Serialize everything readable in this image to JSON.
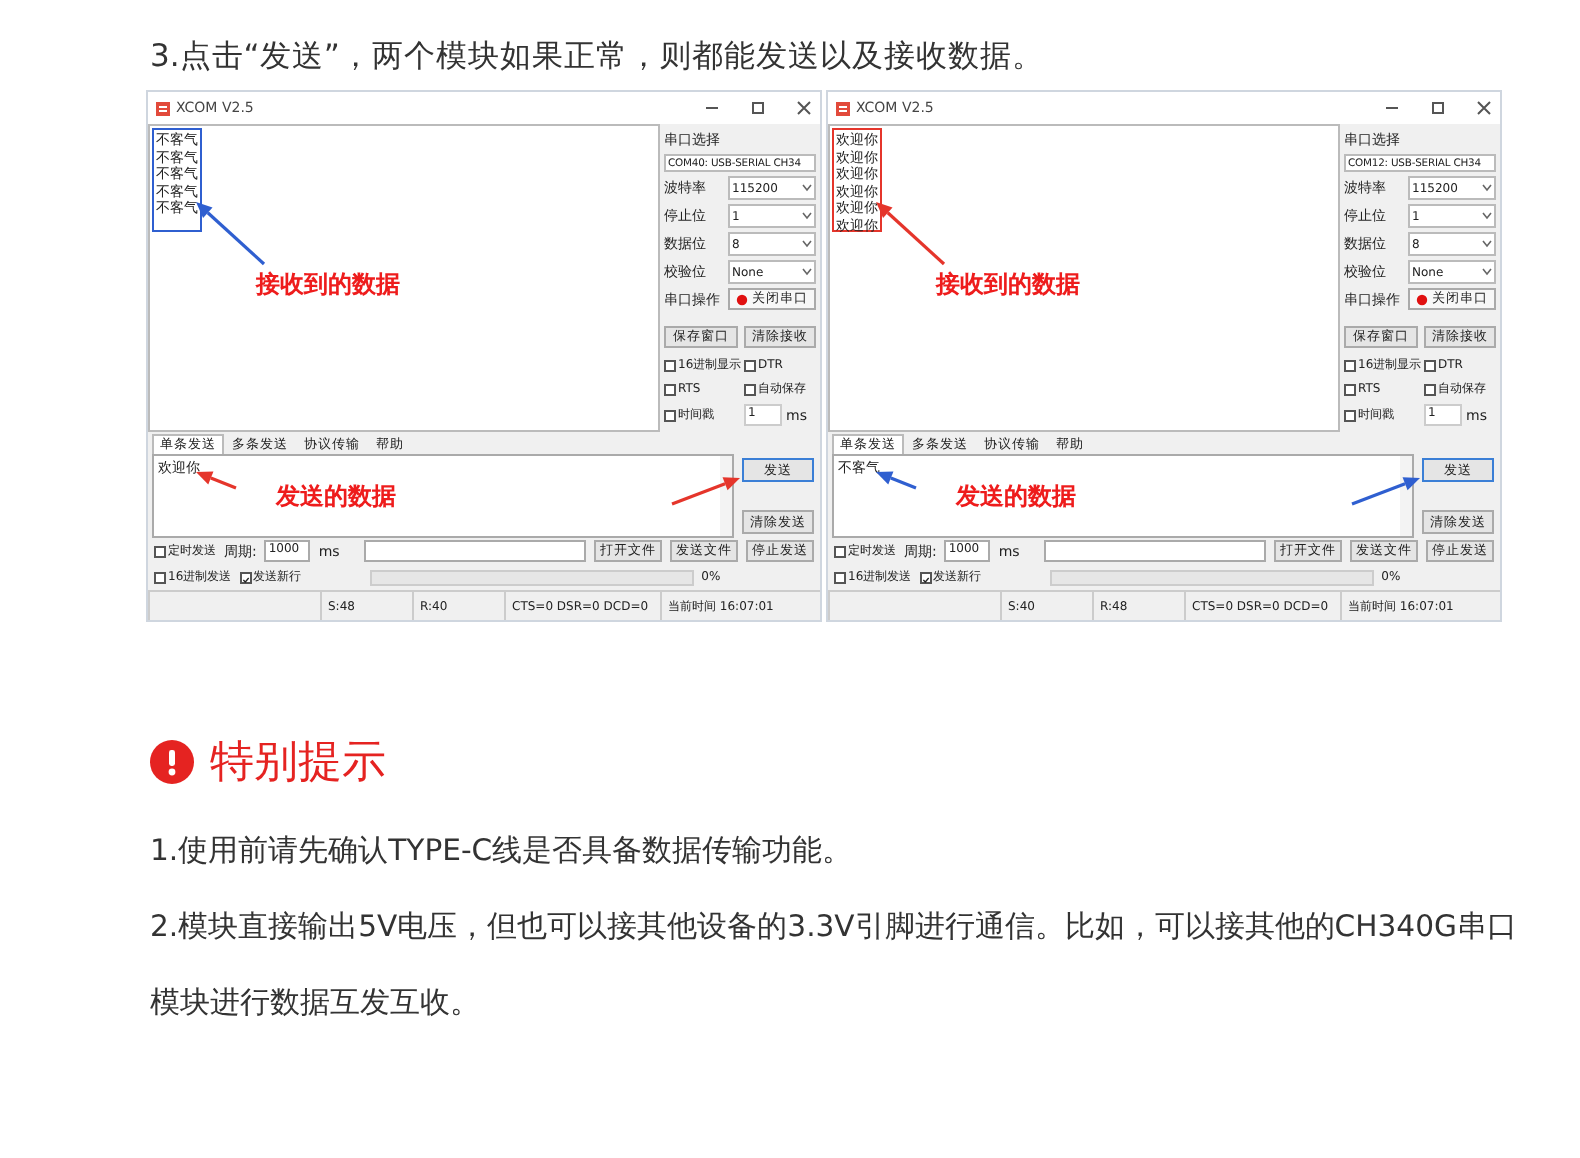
{
  "instruction": "3.点击“发送”，两个模块如果正常，则都能发送以及接收数据。",
  "windows": [
    {
      "title": "XCOM V2.5",
      "received_lines": [
        "不客气",
        "不客气",
        "不客气",
        "不客气",
        "不客气"
      ],
      "annotations": [
        {
          "kind": "received",
          "label": "接收到的数据",
          "color": "#2f5fd0"
        },
        {
          "kind": "sent",
          "label": "发送的数据",
          "color": "#e5352b"
        }
      ],
      "port_label": "串口选择",
      "port": "COM40: USB-SERIAL CH34",
      "settings": [
        {
          "label": "波特率",
          "value": "115200"
        },
        {
          "label": "停止位",
          "value": "1"
        },
        {
          "label": "数据位",
          "value": "8"
        },
        {
          "label": "校验位",
          "value": "None"
        }
      ],
      "port_op_label": "串口操作",
      "port_button": "关闭串口",
      "save_button": "保存窗口",
      "clear_receive_button": "清除接收",
      "checkboxes": [
        {
          "label": "16进制显示",
          "checked": false
        },
        {
          "label": "DTR",
          "checked": false
        },
        {
          "label": "RTS",
          "checked": false
        },
        {
          "label": "自动保存",
          "checked": false
        },
        {
          "label": "时间戳",
          "checked": false
        }
      ],
      "timestamp_value": "1",
      "timestamp_unit": "ms",
      "tabs": [
        {
          "label": "单条发送",
          "selected": true
        },
        {
          "label": "多条发送",
          "selected": false
        },
        {
          "label": "协议传输",
          "selected": false
        },
        {
          "label": "帮助",
          "selected": false
        }
      ],
      "send_text": "欢迎你",
      "send_button": "发送",
      "clear_send_button": "清除发送",
      "timed_send": {
        "label": "定时发送",
        "checked": false
      },
      "period_label": "周期:",
      "period": "1000",
      "period_unit": "ms",
      "file_buttons": [
        "打开文件",
        "发送文件",
        "停止发送"
      ],
      "hex_send": {
        "label": "16进制发送",
        "checked": false
      },
      "new_line": {
        "label": "发送新行",
        "checked": true
      },
      "progress": {
        "level": 0
      },
      "progress_text": "0%",
      "status": [
        "S:48",
        "R:40",
        "CTS=0 DSR=0 DCD=0",
        "当前时间 16:07:01"
      ]
    },
    {
      "title": "XCOM V2.5",
      "received_lines": [
        "欢迎你",
        "欢迎你",
        "欢迎你",
        "欢迎你",
        "欢迎你",
        "欢迎你"
      ],
      "annotations": [
        {
          "kind": "received",
          "label": "接收到的数据",
          "color": "#e5352b"
        },
        {
          "kind": "sent",
          "label": "发送的数据",
          "color": "#2f5fd0"
        }
      ],
      "port_label": "串口选择",
      "port": "COM12: USB-SERIAL CH34",
      "settings": [
        {
          "label": "波特率",
          "value": "115200"
        },
        {
          "label": "停止位",
          "value": "1"
        },
        {
          "label": "数据位",
          "value": "8"
        },
        {
          "label": "校验位",
          "value": "None"
        }
      ],
      "port_op_label": "串口操作",
      "port_button": "关闭串口",
      "save_button": "保存窗口",
      "clear_receive_button": "清除接收",
      "checkboxes": [
        {
          "label": "16进制显示",
          "checked": false
        },
        {
          "label": "DTR",
          "checked": false
        },
        {
          "label": "RTS",
          "checked": false
        },
        {
          "label": "自动保存",
          "checked": false
        },
        {
          "label": "时间戳",
          "checked": false
        }
      ],
      "timestamp_value": "1",
      "timestamp_unit": "ms",
      "tabs": [
        {
          "label": "单条发送",
          "selected": true
        },
        {
          "label": "多条发送",
          "selected": false
        },
        {
          "label": "协议传输",
          "selected": false
        },
        {
          "label": "帮助",
          "selected": false
        }
      ],
      "send_text": "不客气",
      "send_button": "发送",
      "clear_send_button": "清除发送",
      "timed_send": {
        "label": "定时发送",
        "checked": false
      },
      "period_label": "周期:",
      "period": "1000",
      "period_unit": "ms",
      "file_buttons": [
        "打开文件",
        "发送文件",
        "停止发送"
      ],
      "hex_send": {
        "label": "16进制发送",
        "checked": false
      },
      "new_line": {
        "label": "发送新行",
        "checked": true
      },
      "progress": {
        "level": 0
      },
      "progress_text": "0%",
      "status": [
        "S:40",
        "R:48",
        "CTS=0 DSR=0 DCD=0",
        "当前时间 16:07:01"
      ]
    }
  ],
  "notice": {
    "title": "特别提示",
    "paragraphs": [
      "1.使用前请先确认TYPE-C线是否具备数据传输功能。",
      "2.模块直接输出5V电压，但也可以接其他设备的3.3V引脚进行通信。比如，可以接其他的CH340G串口模块进行数据互发互收。"
    ]
  }
}
